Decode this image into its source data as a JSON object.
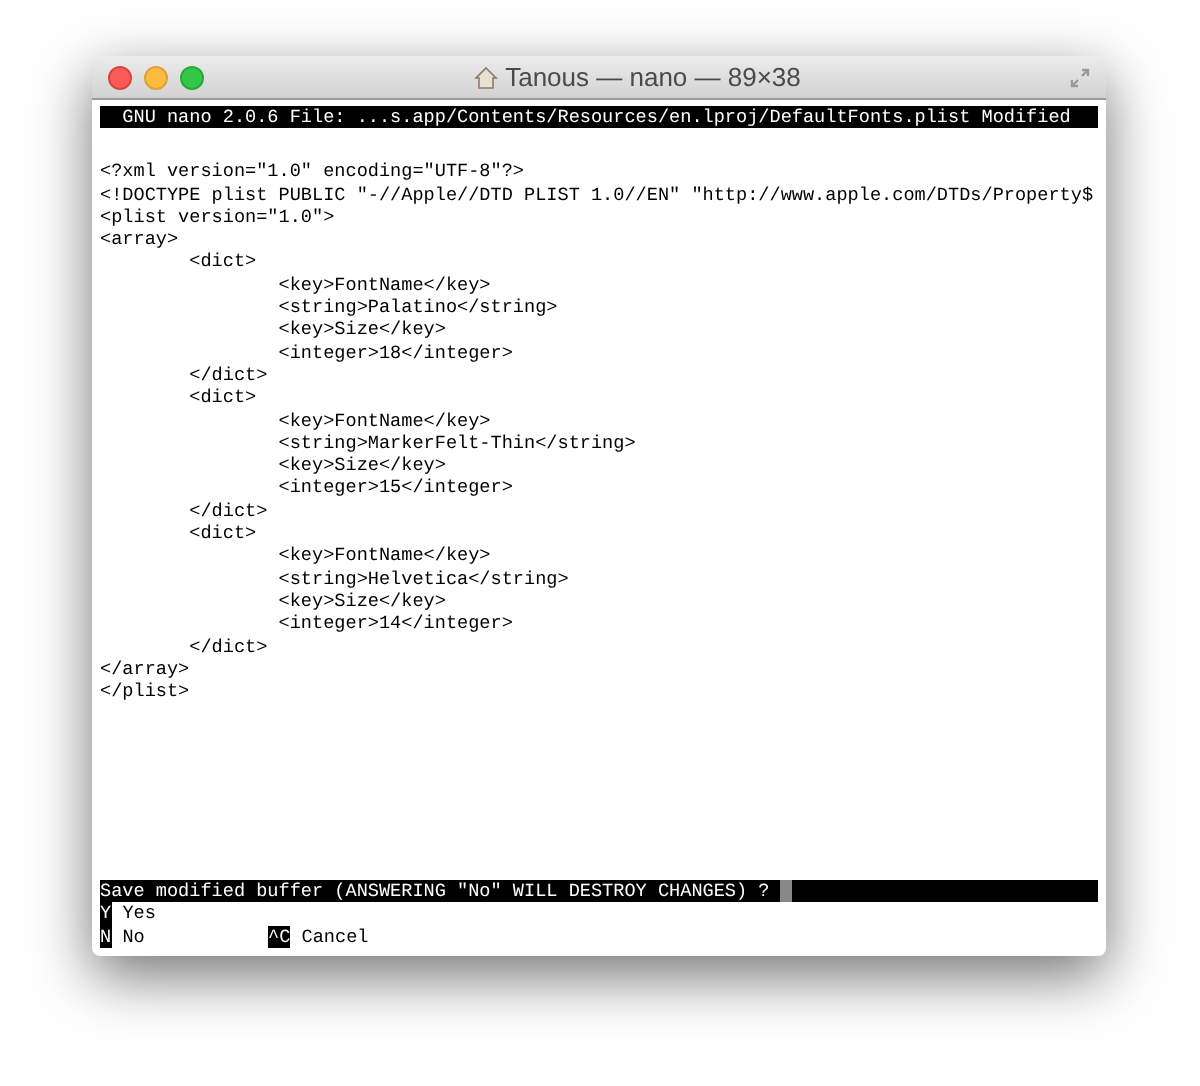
{
  "window": {
    "title": "Tanous — nano — 89×38"
  },
  "title_bar": "  GNU nano 2.0.6 File: ...s.app/Contents/Resources/en.lproj/DefaultFonts.plist Modified",
  "lines": [
    "<?xml version=\"1.0\" encoding=\"UTF-8\"?>",
    "<!DOCTYPE plist PUBLIC \"-//Apple//DTD PLIST 1.0//EN\" \"http://www.apple.com/DTDs/Property$",
    "<plist version=\"1.0\">",
    "<array>",
    "        <dict>",
    "                <key>FontName</key>",
    "                <string>Palatino</string>",
    "                <key>Size</key>",
    "                <integer>18</integer>",
    "        </dict>",
    "        <dict>",
    "                <key>FontName</key>",
    "                <string>MarkerFelt-Thin</string>",
    "                <key>Size</key>",
    "                <integer>15</integer>",
    "        </dict>",
    "        <dict>",
    "                <key>FontName</key>",
    "                <string>Helvetica</string>",
    "                <key>Size</key>",
    "                <integer>14</integer>",
    "        </dict>",
    "</array>",
    "</plist>"
  ],
  "prompt": "Save modified buffer (ANSWERING \"No\" WILL DESTROY CHANGES) ?",
  "shortcut_rows": [
    [
      {
        "key": "Y",
        "label": "Yes"
      }
    ],
    [
      {
        "key": "N",
        "label": "No"
      },
      {
        "key": "^C",
        "label": "Cancel"
      }
    ]
  ]
}
